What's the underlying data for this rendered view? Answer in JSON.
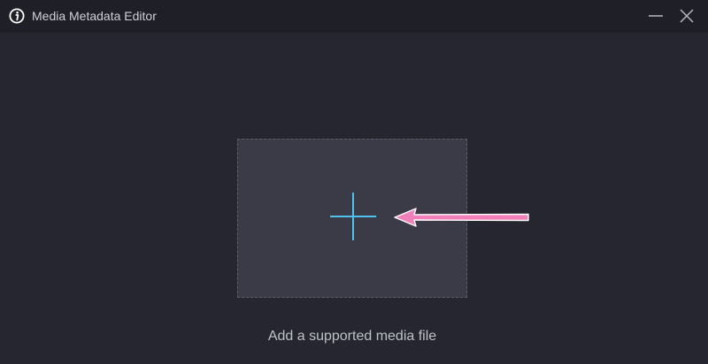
{
  "window": {
    "title": "Media Metadata Editor",
    "icon": "info-icon",
    "controls": {
      "minimize_icon": "minimize-icon",
      "close_icon": "close-icon"
    }
  },
  "dropzone": {
    "icon": "plus-icon",
    "hint": "Add a supported media file"
  },
  "annotation": {
    "icon": "arrow-left-icon",
    "color": "#f17fb9"
  },
  "colors": {
    "background": "#25262f",
    "titlebar": "#1f2027",
    "dropzone": "#3a3b47",
    "accent": "#4ec3ee"
  }
}
